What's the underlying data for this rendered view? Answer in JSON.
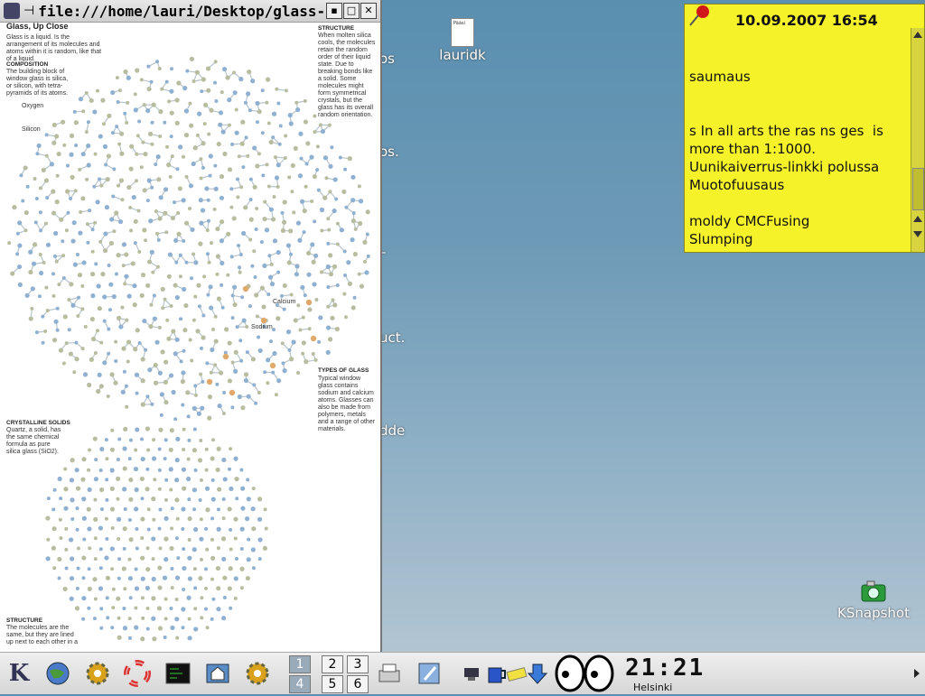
{
  "window": {
    "title": "file:///home/lauri/Desktop/glass-str",
    "buttons": {
      "menu": "▪",
      "maximize": "□",
      "close": "✕"
    },
    "doc": {
      "title": "Glass, Up Close",
      "intro": "Glass is a liquid. Is the arrangement of its molecules and atoms within it is random, like that of a liquid.",
      "composition_h": "COMPOSITION",
      "composition": "The building block of window glass is silica, or silicon, with tetra-pyramids of its atoms.",
      "oxygen": "Oxygen",
      "silicon": "Silicon",
      "structure_h": "STRUCTURE",
      "structure": "When molten silica cools, the molecules retain the random order of their liquid state. Due to breaking bonds like a solid. Some molecules might form symmetrical crystals, but the glass has its overall random orientation.",
      "calcium": "Calcium",
      "sodium": "Sodium",
      "types_h": "TYPES OF GLASS",
      "types": "Typical window glass contains sodium and calcium atoms. Glasses can also be made from polymers, metals and a range of other materials.",
      "crystal_h": "CRYSTALLINE SOLIDS",
      "crystal": "Quartz, a solid, has the same chemical formula as pure silica glass (SiO2).",
      "structure2_h": "STRUCTURE",
      "structure2": "The molecules are the same, but they are lined up next to each other in a"
    }
  },
  "desktop": {
    "icons": [
      {
        "label": "lauridk",
        "icon": "text-file-icon",
        "file_text": "Pääsi"
      },
      {
        "label": "KSnapshot",
        "icon": "camera-icon"
      }
    ],
    "peek_text": [
      "os",
      "os.",
      "–",
      "uct.",
      "dde"
    ]
  },
  "note": {
    "date": "10.09.2007 16:54",
    "body": "saumaus\n\n\ns In all arts the ras ns ges  is more than 1:1000.\nUunikaiverrus-linkki polussa\nMuotofuusaus\n\nmoldy CMCFusing\nSlumping"
  },
  "taskbar": {
    "desktops": [
      "1",
      "2",
      "3",
      "4",
      "5",
      "6"
    ],
    "clock": "21:21",
    "city": "Helsinki",
    "launchers": [
      "kde-menu-icon",
      "globe-icon",
      "gear-icon",
      "lifebuoy-icon",
      "terminal-icon",
      "home-icon",
      "gear-icon"
    ],
    "tray": [
      "printer-icon",
      "pen-icon",
      "network-icon",
      "mug-icon",
      "notes-icon",
      "download-icon",
      "eyes-icon"
    ]
  },
  "colors": {
    "note": "#f5f22a",
    "desktop_top": "#5a8fb0",
    "desktop_bottom": "#b9c9d4"
  }
}
